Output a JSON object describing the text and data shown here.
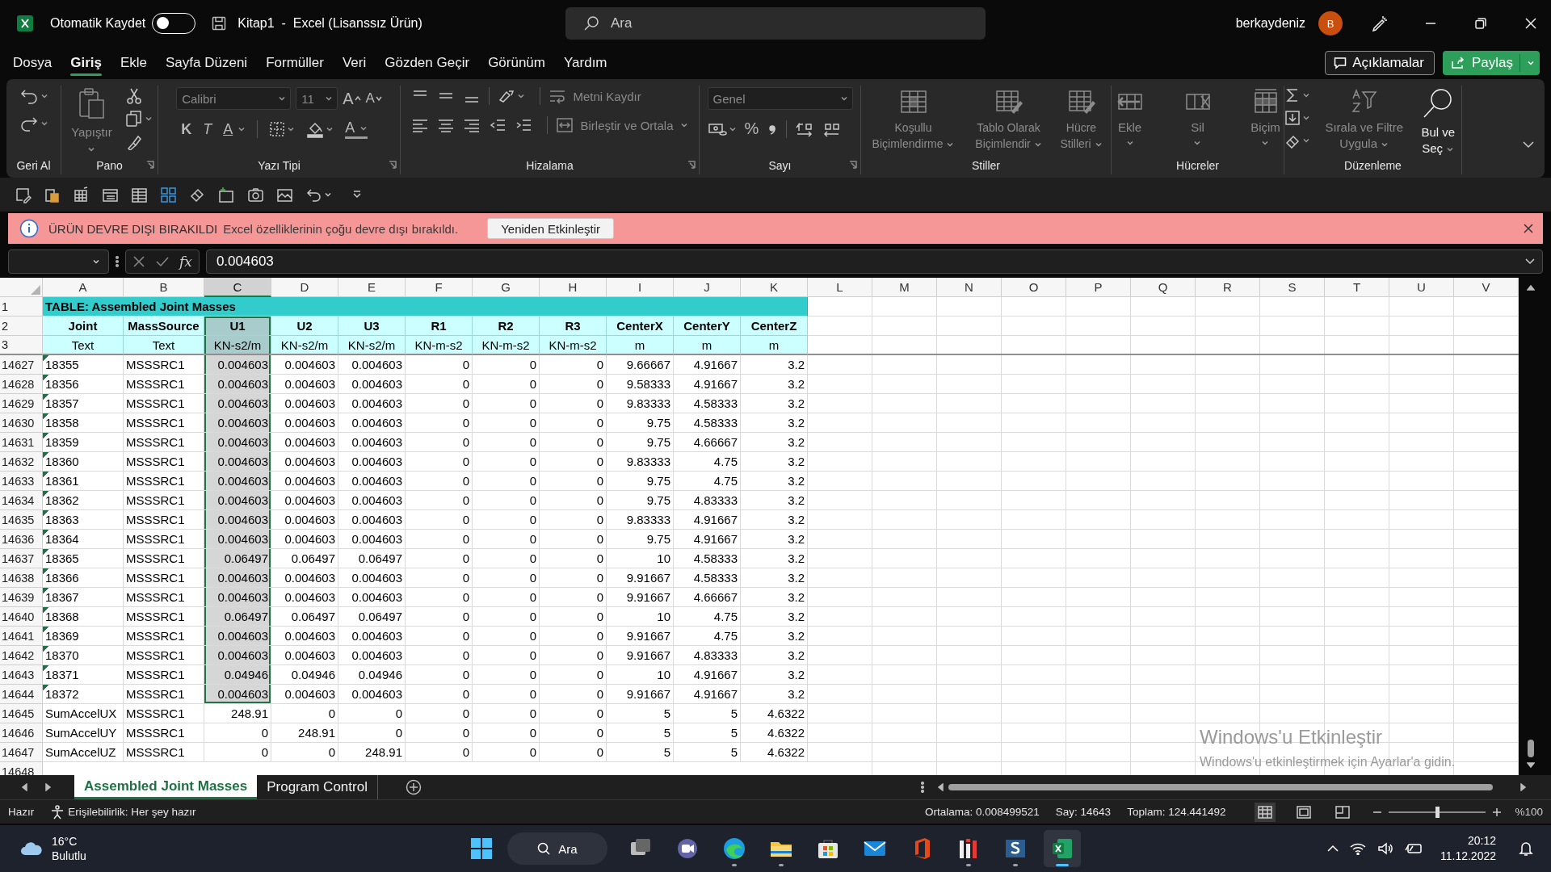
{
  "title_bar": {
    "autosave_label": "Otomatik Kaydet",
    "autosave_on": false,
    "document_title": "Kitap1  -  Excel (Lisanssız Ürün)",
    "search_placeholder": "Ara",
    "user_name": "berkaydeniz",
    "avatar_initial": "B"
  },
  "menu_tabs": [
    {
      "label": "Dosya",
      "selected": false
    },
    {
      "label": "Giriş",
      "selected": true
    },
    {
      "label": "Ekle",
      "selected": false
    },
    {
      "label": "Sayfa Düzeni",
      "selected": false
    },
    {
      "label": "Formüller",
      "selected": false
    },
    {
      "label": "Veri",
      "selected": false
    },
    {
      "label": "Gözden Geçir",
      "selected": false
    },
    {
      "label": "Görünüm",
      "selected": false
    },
    {
      "label": "Yardım",
      "selected": false
    }
  ],
  "comments_button": "Açıklamalar",
  "share_button": "Paylaş",
  "ribbon": {
    "groups": [
      {
        "kind": "undo",
        "label": "Geri Al"
      },
      {
        "kind": "clipboard",
        "label": "Pano",
        "paste_label": "Yapıştır"
      },
      {
        "kind": "font",
        "label": "Yazı Tipi",
        "font_name": "Calibri",
        "font_size": "11",
        "grow_label": "A",
        "shrink_label": "A",
        "bold_label": "K",
        "italic_label": "T",
        "underline_label": "A",
        "font_color_label": "A"
      },
      {
        "kind": "alignment",
        "label": "Hizalama",
        "wrap_label": "Metni Kaydır",
        "merge_label": "Birleştir ve Ortala"
      },
      {
        "kind": "number",
        "label": "Sayı",
        "format": "Genel",
        "percent_label": "%"
      },
      {
        "kind": "styles",
        "label": "Stiller",
        "buttons": [
          "Koşullu Biçimlendirme",
          "Tablo Olarak Biçimlendir",
          "Hücre Stilleri"
        ]
      },
      {
        "kind": "cells",
        "label": "Hücreler",
        "buttons": [
          "Ekle",
          "Sil",
          "Biçim"
        ]
      },
      {
        "kind": "editing",
        "label": "Düzenleme",
        "sort_label": "Sırala ve Filtre Uygula",
        "find_label": "Bul ve Seç"
      }
    ]
  },
  "notice": {
    "title": "ÜRÜN DEVRE DIŞI BIRAKILDI",
    "message": "Excel özelliklerinin çoğu devre dışı bırakıldı.",
    "button": "Yeniden Etkinleştir"
  },
  "formula_bar": {
    "function_label": "fx",
    "value": "0.004603"
  },
  "sheet": {
    "columns": [
      {
        "label": "A",
        "selected": false
      },
      {
        "label": "B",
        "selected": false
      },
      {
        "label": "C",
        "selected": true
      },
      {
        "label": "D",
        "selected": false
      },
      {
        "label": "E",
        "selected": false
      },
      {
        "label": "F",
        "selected": false
      },
      {
        "label": "G",
        "selected": false
      },
      {
        "label": "H",
        "selected": false
      },
      {
        "label": "I",
        "selected": false
      },
      {
        "label": "J",
        "selected": false
      },
      {
        "label": "K",
        "selected": false
      },
      {
        "label": "L",
        "selected": false
      },
      {
        "label": "M",
        "selected": false
      },
      {
        "label": "N",
        "selected": false
      },
      {
        "label": "O",
        "selected": false
      },
      {
        "label": "P",
        "selected": false
      },
      {
        "label": "Q",
        "selected": false
      },
      {
        "label": "R",
        "selected": false
      },
      {
        "label": "S",
        "selected": false
      },
      {
        "label": "T",
        "selected": false
      },
      {
        "label": "U",
        "selected": false
      },
      {
        "label": "V",
        "selected": false
      }
    ],
    "rows": [
      {
        "kind": "title",
        "number": "1",
        "cells": [
          "TABLE:  Assembled Joint Masses"
        ],
        "selected": false,
        "error_marker": false
      },
      {
        "kind": "header",
        "number": "2",
        "cells": [
          "Joint",
          "MassSource",
          "U1",
          "U2",
          "U3",
          "R1",
          "R2",
          "R3",
          "CenterX",
          "CenterY",
          "CenterZ"
        ],
        "selected": true,
        "error_marker": false
      },
      {
        "kind": "units",
        "number": "3",
        "cells": [
          "Text",
          "Text",
          "KN-s2/m",
          "KN-s2/m",
          "KN-s2/m",
          "KN-m-s2",
          "KN-m-s2",
          "KN-m-s2",
          "m",
          "m",
          "m"
        ],
        "selected": true,
        "error_marker": false
      },
      {
        "kind": "data",
        "number": "14627",
        "cells": [
          "18355",
          "MSSSRC1",
          "0.004603",
          "0.004603",
          "0.004603",
          "0",
          "0",
          "0",
          "9.66667",
          "4.91667",
          "3.2"
        ],
        "selected": true,
        "error_marker": true
      },
      {
        "kind": "data",
        "number": "14628",
        "cells": [
          "18356",
          "MSSSRC1",
          "0.004603",
          "0.004603",
          "0.004603",
          "0",
          "0",
          "0",
          "9.58333",
          "4.91667",
          "3.2"
        ],
        "selected": true,
        "error_marker": true
      },
      {
        "kind": "data",
        "number": "14629",
        "cells": [
          "18357",
          "MSSSRC1",
          "0.004603",
          "0.004603",
          "0.004603",
          "0",
          "0",
          "0",
          "9.83333",
          "4.58333",
          "3.2"
        ],
        "selected": true,
        "error_marker": true
      },
      {
        "kind": "data",
        "number": "14630",
        "cells": [
          "18358",
          "MSSSRC1",
          "0.004603",
          "0.004603",
          "0.004603",
          "0",
          "0",
          "0",
          "9.75",
          "4.58333",
          "3.2"
        ],
        "selected": true,
        "error_marker": true
      },
      {
        "kind": "data",
        "number": "14631",
        "cells": [
          "18359",
          "MSSSRC1",
          "0.004603",
          "0.004603",
          "0.004603",
          "0",
          "0",
          "0",
          "9.75",
          "4.66667",
          "3.2"
        ],
        "selected": true,
        "error_marker": true
      },
      {
        "kind": "data",
        "number": "14632",
        "cells": [
          "18360",
          "MSSSRC1",
          "0.004603",
          "0.004603",
          "0.004603",
          "0",
          "0",
          "0",
          "9.83333",
          "4.75",
          "3.2"
        ],
        "selected": true,
        "error_marker": true
      },
      {
        "kind": "data",
        "number": "14633",
        "cells": [
          "18361",
          "MSSSRC1",
          "0.004603",
          "0.004603",
          "0.004603",
          "0",
          "0",
          "0",
          "9.75",
          "4.75",
          "3.2"
        ],
        "selected": true,
        "error_marker": true
      },
      {
        "kind": "data",
        "number": "14634",
        "cells": [
          "18362",
          "MSSSRC1",
          "0.004603",
          "0.004603",
          "0.004603",
          "0",
          "0",
          "0",
          "9.75",
          "4.83333",
          "3.2"
        ],
        "selected": true,
        "error_marker": true
      },
      {
        "kind": "data",
        "number": "14635",
        "cells": [
          "18363",
          "MSSSRC1",
          "0.004603",
          "0.004603",
          "0.004603",
          "0",
          "0",
          "0",
          "9.83333",
          "4.91667",
          "3.2"
        ],
        "selected": true,
        "error_marker": true
      },
      {
        "kind": "data",
        "number": "14636",
        "cells": [
          "18364",
          "MSSSRC1",
          "0.004603",
          "0.004603",
          "0.004603",
          "0",
          "0",
          "0",
          "9.75",
          "4.91667",
          "3.2"
        ],
        "selected": true,
        "error_marker": true
      },
      {
        "kind": "data",
        "number": "14637",
        "cells": [
          "18365",
          "MSSSRC1",
          "0.06497",
          "0.06497",
          "0.06497",
          "0",
          "0",
          "0",
          "10",
          "4.58333",
          "3.2"
        ],
        "selected": true,
        "error_marker": true
      },
      {
        "kind": "data",
        "number": "14638",
        "cells": [
          "18366",
          "MSSSRC1",
          "0.004603",
          "0.004603",
          "0.004603",
          "0",
          "0",
          "0",
          "9.91667",
          "4.58333",
          "3.2"
        ],
        "selected": true,
        "error_marker": true
      },
      {
        "kind": "data",
        "number": "14639",
        "cells": [
          "18367",
          "MSSSRC1",
          "0.004603",
          "0.004603",
          "0.004603",
          "0",
          "0",
          "0",
          "9.91667",
          "4.66667",
          "3.2"
        ],
        "selected": true,
        "error_marker": true
      },
      {
        "kind": "data",
        "number": "14640",
        "cells": [
          "18368",
          "MSSSRC1",
          "0.06497",
          "0.06497",
          "0.06497",
          "0",
          "0",
          "0",
          "10",
          "4.75",
          "3.2"
        ],
        "selected": true,
        "error_marker": true
      },
      {
        "kind": "data",
        "number": "14641",
        "cells": [
          "18369",
          "MSSSRC1",
          "0.004603",
          "0.004603",
          "0.004603",
          "0",
          "0",
          "0",
          "9.91667",
          "4.75",
          "3.2"
        ],
        "selected": true,
        "error_marker": true
      },
      {
        "kind": "data",
        "number": "14642",
        "cells": [
          "18370",
          "MSSSRC1",
          "0.004603",
          "0.004603",
          "0.004603",
          "0",
          "0",
          "0",
          "9.91667",
          "4.83333",
          "3.2"
        ],
        "selected": true,
        "error_marker": true
      },
      {
        "kind": "data",
        "number": "14643",
        "cells": [
          "18371",
          "MSSSRC1",
          "0.04946",
          "0.04946",
          "0.04946",
          "0",
          "0",
          "0",
          "10",
          "4.91667",
          "3.2"
        ],
        "selected": true,
        "error_marker": true
      },
      {
        "kind": "data",
        "number": "14644",
        "cells": [
          "18372",
          "MSSSRC1",
          "0.004603",
          "0.004603",
          "0.004603",
          "0",
          "0",
          "0",
          "9.91667",
          "4.91667",
          "3.2"
        ],
        "selected": true,
        "error_marker": true
      },
      {
        "kind": "data",
        "number": "14645",
        "cells": [
          "SumAccelUX",
          "MSSSRC1",
          "248.91",
          "0",
          "0",
          "0",
          "0",
          "0",
          "5",
          "5",
          "4.6322"
        ],
        "selected": false,
        "error_marker": false
      },
      {
        "kind": "data",
        "number": "14646",
        "cells": [
          "SumAccelUY",
          "MSSSRC1",
          "0",
          "248.91",
          "0",
          "0",
          "0",
          "0",
          "5",
          "5",
          "4.6322"
        ],
        "selected": false,
        "error_marker": false
      },
      {
        "kind": "data",
        "number": "14647",
        "cells": [
          "SumAccelUZ",
          "MSSSRC1",
          "0",
          "0",
          "248.91",
          "0",
          "0",
          "0",
          "5",
          "5",
          "4.6322"
        ],
        "selected": false,
        "error_marker": false
      },
      {
        "kind": "data",
        "number": "14648",
        "cells": [],
        "selected": false,
        "error_marker": false
      }
    ]
  },
  "activation": {
    "title": "Windows'u Etkinleştir",
    "message": "Windows'u etkinleştirmek için Ayarlar'a gidin."
  },
  "sheet_tabs": [
    {
      "label": "Assembled Joint Masses",
      "selected": true
    },
    {
      "label": "Program Control",
      "selected": false
    }
  ],
  "status_bar": {
    "mode": "Hazır",
    "accessibility": "Erişilebilirlik: Her şey hazır",
    "average": "Ortalama: 0.008499521",
    "count": "Say: 14643",
    "sum": "Toplam: 124.441492",
    "zoom_slider": {
      "level": 0.5
    },
    "zoom": "%100"
  },
  "taskbar": {
    "weather_temp": "16°C",
    "weather_text": "Bulutlu",
    "search_label": "Ara",
    "apps": [
      {
        "kind": "task-view",
        "running": false,
        "active": false
      },
      {
        "kind": "chat",
        "running": false,
        "active": false
      },
      {
        "kind": "browser",
        "running": true,
        "active": false
      },
      {
        "kind": "folder",
        "running": true,
        "active": false
      },
      {
        "kind": "store",
        "running": false,
        "active": false
      },
      {
        "kind": "mail",
        "running": false,
        "active": false
      },
      {
        "kind": "office",
        "running": false,
        "active": false
      },
      {
        "kind": "bars",
        "running": true,
        "active": false
      },
      {
        "kind": "s-app",
        "running": true,
        "active": false
      },
      {
        "kind": "spreadsheet",
        "running": true,
        "active": true
      }
    ],
    "time": "20:12",
    "date": "11.12.2022"
  }
}
